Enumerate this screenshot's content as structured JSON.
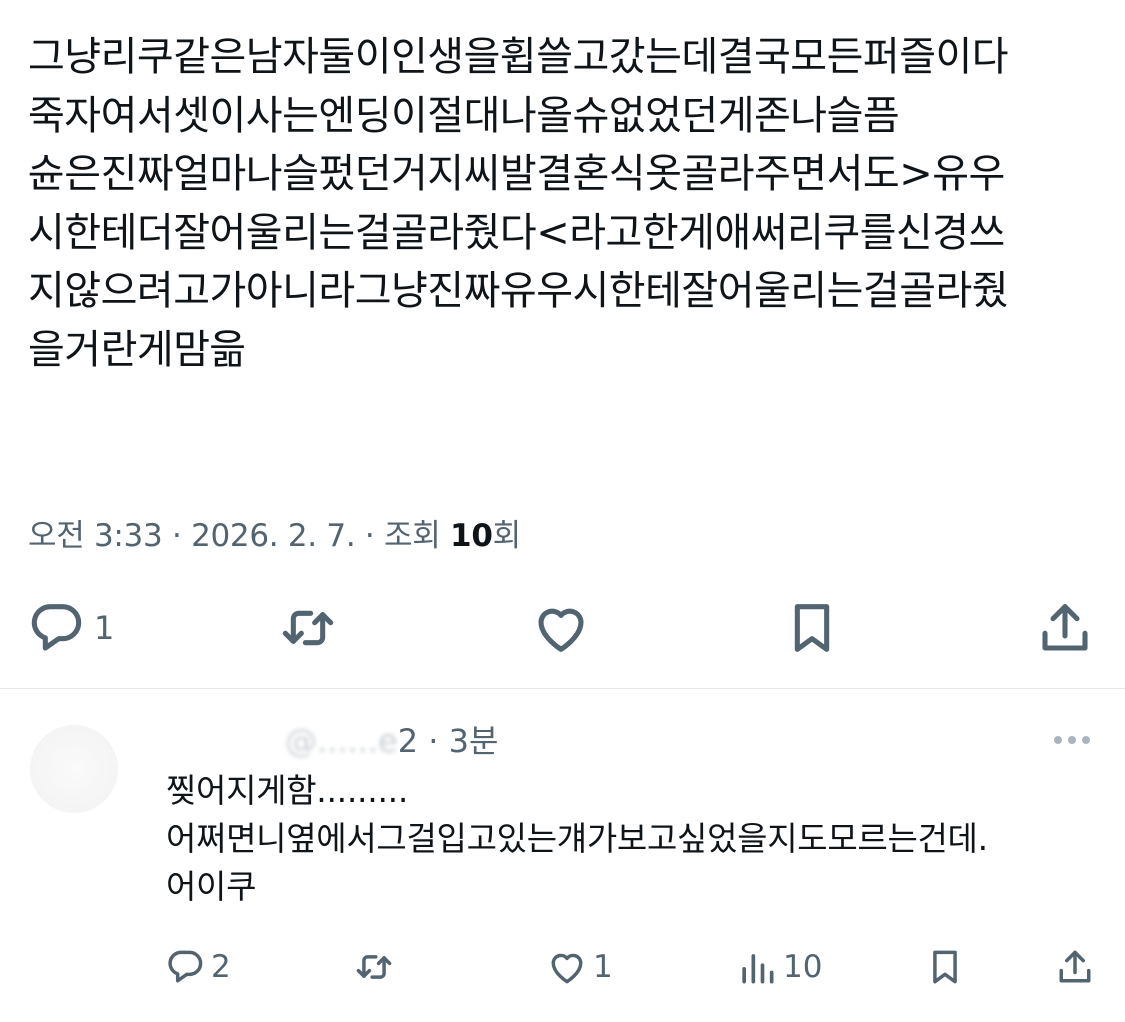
{
  "tweet": {
    "lines": [
      "그냥리쿠같은남자둘이인생을휩쓸고갔는데결국모든퍼즐이다",
      "죽자여서셋이사는엔딩이절대나올슈없었던게존나슬픔",
      "슌은진짜얼마나슬펐던거지씨발결혼식옷골라주면서도>유우",
      "시한테더잘어울리는걸골라줬다<라고한게애써리쿠를신경쓰",
      "지않으려고가아니라그냥진짜유우시한테잘어울리는걸골라줬",
      "을거란게맘읆"
    ],
    "meta": {
      "time_date": "오전 3:33 · 2026. 2. 7. · 조회 ",
      "views": "10",
      "views_suffix": "회"
    },
    "actions": {
      "reply_count": "1",
      "reply_icon": "reply-icon",
      "retweet_icon": "retweet-icon",
      "like_icon": "heart-icon",
      "bookmark_icon": "bookmark-icon",
      "share_icon": "share-icon"
    }
  },
  "reply": {
    "handle": "@......e",
    "handle_suffix": "2 · 3분",
    "lines": [
      "찢어지게함.........",
      "어쩌면니옆에서그걸입고있는걔가보고싶었을지도모르는건데.",
      "어이쿠"
    ],
    "actions": {
      "reply_count": "2",
      "like_count": "1",
      "views_count": "10"
    }
  },
  "colors": {
    "text": "#0f1419",
    "secondary": "#536471",
    "divider": "#e6e9ec"
  }
}
